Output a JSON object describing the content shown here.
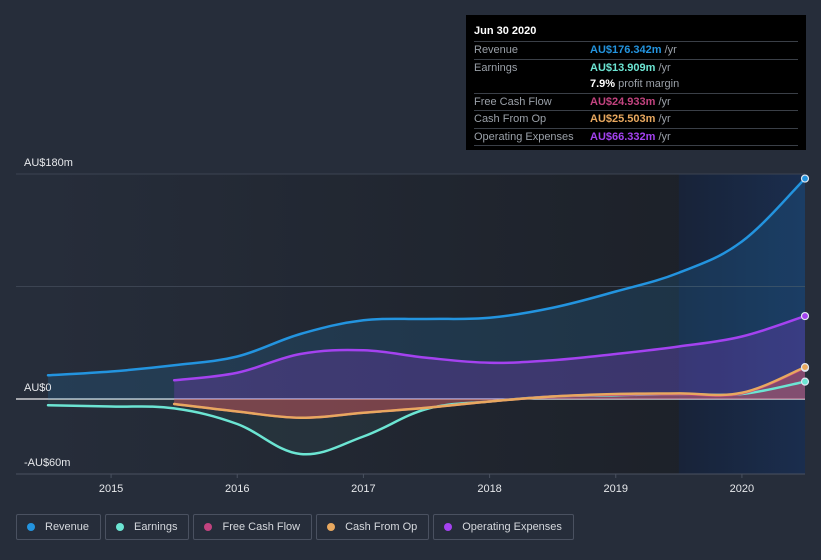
{
  "tooltip": {
    "date": "Jun 30 2020",
    "rows": [
      {
        "label": "Revenue",
        "value": "AU$176.342m",
        "unit": "/yr",
        "color": "#2394df"
      },
      {
        "label": "Earnings",
        "value": "AU$13.909m",
        "unit": "/yr",
        "color": "#6ce5d3"
      },
      {
        "label": "",
        "value": "7.9%",
        "unit": "profit margin",
        "color": "#ffffff"
      },
      {
        "label": "Free Cash Flow",
        "value": "AU$24.933m",
        "unit": "/yr",
        "color": "#c2437f"
      },
      {
        "label": "Cash From Op",
        "value": "AU$25.503m",
        "unit": "/yr",
        "color": "#e8a85f"
      },
      {
        "label": "Operating Expenses",
        "value": "AU$66.332m",
        "unit": "/yr",
        "color": "#a442f0"
      }
    ]
  },
  "legend": [
    {
      "label": "Revenue",
      "color": "#2394df"
    },
    {
      "label": "Earnings",
      "color": "#6ce5d3"
    },
    {
      "label": "Free Cash Flow",
      "color": "#c2437f"
    },
    {
      "label": "Cash From Op",
      "color": "#e8a85f"
    },
    {
      "label": "Operating Expenses",
      "color": "#a442f0"
    }
  ],
  "chart_data": {
    "type": "line",
    "title": "",
    "xlabel": "",
    "ylabel": "",
    "currency_unit": "AU$m",
    "xlim": [
      2014.5,
      2020.5
    ],
    "ylim": [
      -60,
      180
    ],
    "x_ticks": [
      2015,
      2016,
      2017,
      2018,
      2019,
      2020
    ],
    "x_tick_labels": [
      "2015",
      "2016",
      "2017",
      "2018",
      "2019",
      "2020"
    ],
    "y_tick_labels": [
      {
        "value": 180,
        "label": "AU$180m"
      },
      {
        "value": 0,
        "label": "AU$0"
      },
      {
        "value": -60,
        "label": "-AU$60m"
      }
    ],
    "gridlines": [
      180,
      90,
      0
    ],
    "highlight_range": [
      2019.5,
      2020.5
    ],
    "legend_position": "bottom-left",
    "series": [
      {
        "name": "Revenue",
        "color": "#2394df",
        "x": [
          2014.5,
          2015,
          2015.5,
          2016,
          2016.5,
          2017,
          2017.5,
          2018,
          2018.5,
          2019,
          2019.5,
          2020,
          2020.5
        ],
        "values": [
          19,
          22,
          27,
          34,
          52,
          63,
          64,
          65,
          73,
          86,
          101,
          126,
          176.342
        ]
      },
      {
        "name": "Earnings",
        "color": "#6ce5d3",
        "x": [
          2014.5,
          2015,
          2015.5,
          2016,
          2016.5,
          2017,
          2017.5,
          2018,
          2018.5,
          2019,
          2019.5,
          2020,
          2020.5
        ],
        "values": [
          -5,
          -6,
          -7.5,
          -20,
          -44,
          -30,
          -8,
          -2,
          2,
          3,
          4,
          4,
          13.909
        ]
      },
      {
        "name": "Free Cash Flow",
        "color": "#c2437f",
        "x": [
          2015.5,
          2016,
          2016.5,
          2017,
          2017.5,
          2018,
          2018.5,
          2019,
          2019.5,
          2020,
          2020.5
        ],
        "values": [
          -4,
          -10,
          -15,
          -11,
          -7,
          -2,
          2,
          3.5,
          4,
          4.5,
          24.933
        ]
      },
      {
        "name": "Cash From Op",
        "color": "#e8a85f",
        "x": [
          2015.5,
          2016,
          2016.5,
          2017,
          2017.5,
          2018,
          2018.5,
          2019,
          2019.5,
          2020,
          2020.5
        ],
        "values": [
          -4,
          -10,
          -15,
          -11,
          -7,
          -2,
          2,
          4,
          4.5,
          5,
          25.503
        ]
      },
      {
        "name": "Operating Expenses",
        "color": "#a442f0",
        "x": [
          2015.5,
          2016,
          2016.5,
          2017,
          2017.5,
          2018,
          2018.5,
          2019,
          2019.5,
          2020,
          2020.5
        ],
        "values": [
          15,
          21,
          36,
          39,
          33,
          29,
          31,
          36,
          42,
          50,
          66.332
        ]
      }
    ]
  }
}
